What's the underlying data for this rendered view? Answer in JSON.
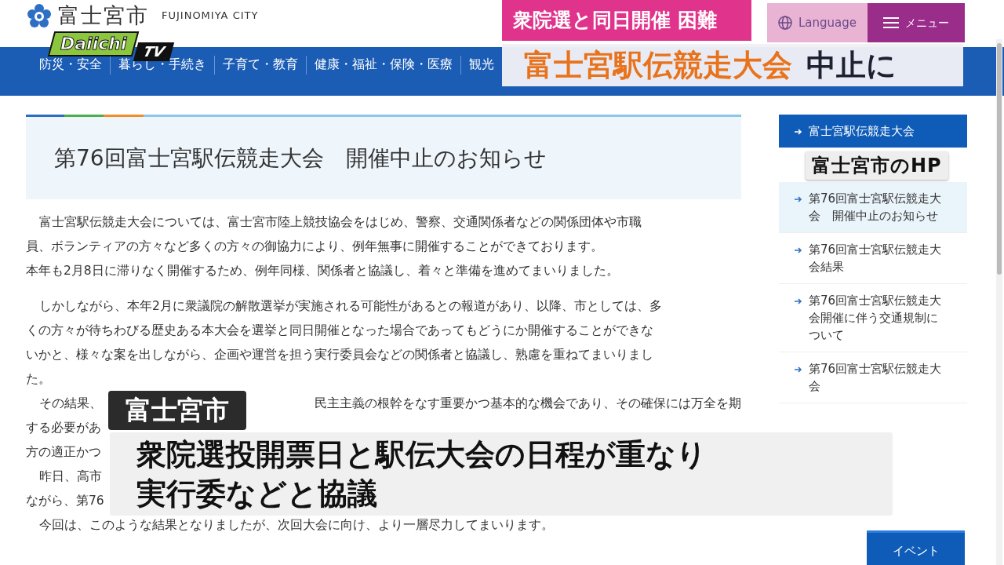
{
  "site": {
    "city_name": "富士宮市",
    "city_name_en": "FUJINOMIYA CITY",
    "language": "Language",
    "menu": "メニュー",
    "nav": [
      {
        "label": "防災・安全"
      },
      {
        "label": "暮らし・手続き"
      },
      {
        "label": "子育て・教育"
      },
      {
        "label": "健康・福祉・保険・医療"
      },
      {
        "label": "観光"
      }
    ],
    "page_title": "第76回富士宮駅伝競走大会　開催中止のお知らせ",
    "paragraphs": [
      {
        "lines": [
          [
            "富士宮駅伝競走大会については、富士宮市陸上競技協会をはじめ、警察、交通関係者などの関係団体や市職"
          ],
          [
            "員、ボランティアの方々など多くの方々の御協力により、例年無事に開催することができております。"
          ],
          [
            "本年も2月8日に滞りなく開催するため、例年同様、関係者と協議し、着々と準備を進めてまいりました。"
          ]
        ]
      },
      {
        "lines": [
          [
            "しかしながら、本年2月に衆議院の解散選挙が実施される可能性があるとの報道があり、以降、市としては、多"
          ],
          [
            "くの方々が待ちわびる歴史ある本大会を選挙と同日開催となった場合であってもどうにか開催することができな"
          ],
          [
            "いかと、様々な案を出しながら、企画や運営を担う実行委員会などの関係者と協議し、熟慮を重ねてまいりまし"
          ],
          [
            "た。"
          ]
        ]
      },
      {
        "lines": [
          [
            "その結果、",
            "民主主義の根幹をなす重要かつ基本的な機会であり、その確保には万全を期"
          ],
          [
            "する必要があ"
          ],
          [
            "方の適正かつ"
          ]
        ]
      },
      {
        "lines": [
          [
            "昨日、高市"
          ],
          [
            "ながら、第76"
          ]
        ]
      },
      {
        "lines": [
          [
            "今回は、このような結果となりましたが、次回大会に向け、より一層尽力してまいります。"
          ]
        ]
      }
    ],
    "sidebar": {
      "heading": "富士宮駅伝競走大会",
      "items": [
        {
          "label": "第76回富士宮駅伝競走大会　開催中止のお知らせ",
          "selected": true
        },
        {
          "label": "第76回富士宮駅伝競走大会結果",
          "selected": false
        },
        {
          "label": "第76回富士宮駅伝競走大会開催に伴う交通規制について",
          "selected": false
        },
        {
          "label": "第76回富士宮駅伝競走大会",
          "selected": false
        }
      ]
    },
    "event_button": "イベント"
  },
  "broadcast": {
    "logo_text": "Daiichi",
    "logo_suffix": "TV",
    "topic": "衆院選と同日開催 困難",
    "headline_main": "富士宮駅伝競走大会",
    "headline_tail": "中止に",
    "source_label": "富士宮市のHP",
    "speaker_label": "富士宮市",
    "caption_lines": [
      "衆院選投開票日と駅伝大会の日程が重なり",
      "実行委などと協議"
    ]
  }
}
